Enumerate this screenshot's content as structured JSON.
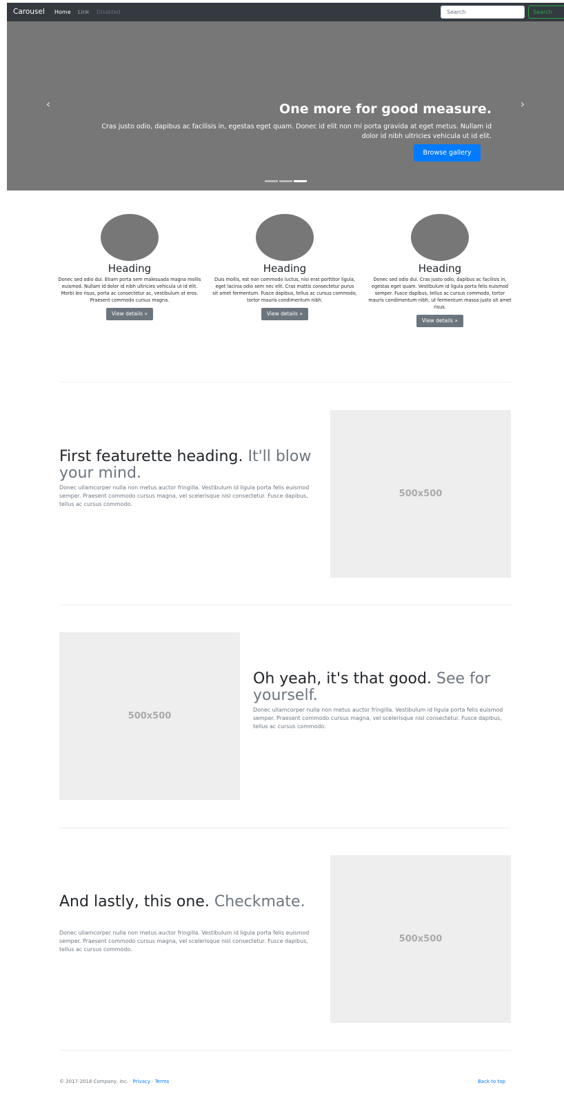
{
  "navbar": {
    "brand": "Carousel",
    "links": [
      "Home",
      "Link",
      "Disabled"
    ],
    "search_placeholder": "Search",
    "search_button": "Search"
  },
  "carousel": {
    "prev_icon": "chevron-left-icon",
    "next_icon": "chevron-right-icon",
    "title": "One more for good measure.",
    "text": "Cras justo odio, dapibus ac facilisis in, egestas eget quam. Donec id elit non mi porta gravida at eget metus. Nullam id dolor id nibh ultricies vehicula ut id elit.",
    "button": "Browse gallery",
    "active_slide": 3,
    "slide_count": 3
  },
  "marketing": [
    {
      "heading": "Heading",
      "text": "Donec sed odio dui. Etiam porta sem malesuada magna mollis euismod. Nullam id dolor id nibh ultricies vehicula ut id elit. Morbi leo risus, porta ac consectetur ac, vestibulum at eros. Praesent commodo cursus magna.",
      "button": "View details »"
    },
    {
      "heading": "Heading",
      "text": "Duis mollis, est non commodo luctus, nisi erat porttitor ligula, eget lacinia odio sem nec elit. Cras mattis consectetur purus sit amet fermentum. Fusce dapibus, tellus ac cursus commodo, tortor mauris condimentum nibh.",
      "button": "View details »"
    },
    {
      "heading": "Heading",
      "text": "Donec sed odio dui. Cras justo odio, dapibus ac facilisis in, egestas eget quam. Vestibulum id ligula porta felis euismod semper. Fusce dapibus, tellus ac cursus commodo, tortor mauris condimentum nibh, ut fermentum massa justo sit amet risus.",
      "button": "View details »"
    }
  ],
  "featurettes": [
    {
      "heading": "First featurette heading.",
      "muted": "It'll blow your mind.",
      "lead": "Donec ullamcorper nulla non metus auctor fringilla. Vestibulum id ligula porta felis euismod semper. Praesent commodo cursus magna, vel scelerisque nisl consectetur. Fusce dapibus, tellus ac cursus commodo.",
      "image_label": "500x500"
    },
    {
      "heading": "Oh yeah, it's that good.",
      "muted": "See for yourself.",
      "lead": "Donec ullamcorper nulla non metus auctor fringilla. Vestibulum id ligula porta felis euismod semper. Praesent commodo cursus magna, vel scelerisque nisl consectetur. Fusce dapibus, tellus ac cursus commodo.",
      "image_label": "500x500"
    },
    {
      "heading": "And lastly, this one.",
      "muted": "Checkmate.",
      "lead": "Donec ullamcorper nulla non metus auctor fringilla. Vestibulum id ligula porta felis euismod semper. Praesent commodo cursus magna, vel scelerisque nisl consectetur. Fusce dapibus, tellus ac cursus commodo.",
      "image_label": "500x500"
    }
  ],
  "footer": {
    "copyright": "© 2017-2018 Company, Inc. ·",
    "privacy": "Privacy",
    "separator": "·",
    "terms": "Terms",
    "back_to_top": "Back to top"
  },
  "colors": {
    "navbar_bg": "#343a40",
    "carousel_bg": "#777777",
    "primary": "#007bff",
    "success": "#28a745",
    "secondary": "#6c757d",
    "placeholder_bg": "#eeeeee"
  }
}
